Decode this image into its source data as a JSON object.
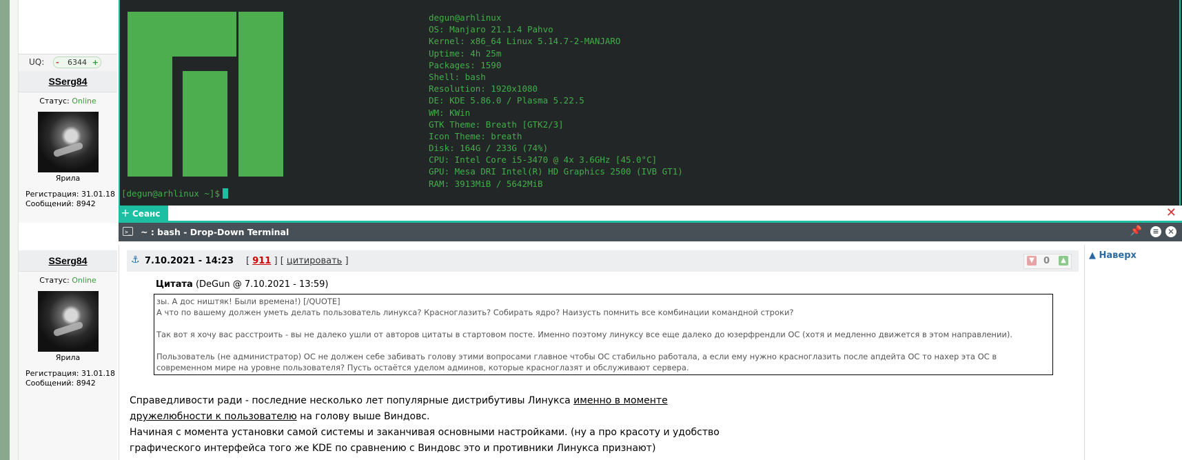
{
  "profile_top": {
    "uq_label": "UQ:",
    "uq_value": "6344",
    "uq_minus": "-",
    "uq_plus": "+",
    "name": "SSerg84",
    "status_label": "Статус:",
    "status_value": "Online",
    "rank": "Ярила",
    "reg_label": "Регистрация: 31.01.18",
    "posts_label": "Сообщений: 8942"
  },
  "terminal": {
    "neofetch": [
      "degun@arhlinux",
      "OS: Manjaro 21.1.4 Pahvo",
      "Kernel: x86_64 Linux 5.14.7-2-MANJARO",
      "Uptime: 4h 25m",
      "Packages: 1590",
      "Shell: bash",
      "Resolution: 1920x1080",
      "DE: KDE 5.86.0 / Plasma 5.22.5",
      "WM: KWin",
      "GTK Theme: Breath [GTK2/3]",
      "Icon Theme: breath",
      "Disk: 164G / 233G (74%)",
      "CPU: Intel Core i5-3470 @ 4x 3.6GHz [45.0°C]",
      "GPU: Mesa DRI Intel(R) HD Graphics 2500 (IVB GT1)",
      "RAM: 3913MiB / 5642MiB"
    ],
    "prompt": "[degun@arhlinux ~]$",
    "tab_label": "Сеанс",
    "tab_plus": "+",
    "tab_close": "✕",
    "window_title": "~ : bash - Drop-Down Terminal",
    "title_icon": ">_",
    "accent": "#1dbfa3",
    "logo_color": "#4cae4f"
  },
  "post": {
    "author": "SSerg84",
    "status_label": "Статус:",
    "status_value": "Online",
    "rank": "Ярила",
    "reg_label": "Регистрация: 31.01.18",
    "posts_label": "Сообщений: 8942",
    "date": "7.10.2021 - 14:23",
    "post_number": "911",
    "cite_label": "цитировать",
    "bracket_open": "[",
    "bracket_mid": "] [",
    "bracket_close": "]",
    "vote_count": "0",
    "top_link": "Наверх",
    "quote_label": "Цитата",
    "quote_source": "(DeGun @ 7.10.2021 - 13:59)",
    "quote_lines": [
      "зы. А дос ништяк! Были времена!) [/QUOTE]",
      "А что по вашему должен уметь делать пользователь линукса? Красноглазить? Собирать ядро? Наизусть помнить все комбинации командной строки?",
      "Так вот я хочу вас расстроить - вы не далеко ушли от авторов цитаты в стартовом посте. Именно поэтому линуксу все еще далеко до юзерфрендли ОС (хотя и медленно движется в этом направлении).",
      "Пользователь (не администратор) ОС не должен себе забивать голову этими вопросами главное чтобы ОС стабильно работала, а если ему нужно красноглазить после апдейта ОС то нахер эта ОС в современном мире на уровне пользователя? Пусть остаётся уделом админов, которые красноглазят и обслуживают сервера."
    ],
    "body_line1_start": "Справедливости ради - последние несколько лет популярные дистрибутивы Линукса ",
    "body_line1_link": "именно в моменте",
    "body_line2_link": "дружелюбности к пользователю",
    "body_line2_end": " на голову выше Виндовс.",
    "body_line3": "Начиная с момента установки самой системы и заканчивая основными настройками. (ну а про красоту и удобство",
    "body_line4": "графического интерфейса того же KDE по сравнению с Виндовс это и противники Линукса признают)"
  }
}
